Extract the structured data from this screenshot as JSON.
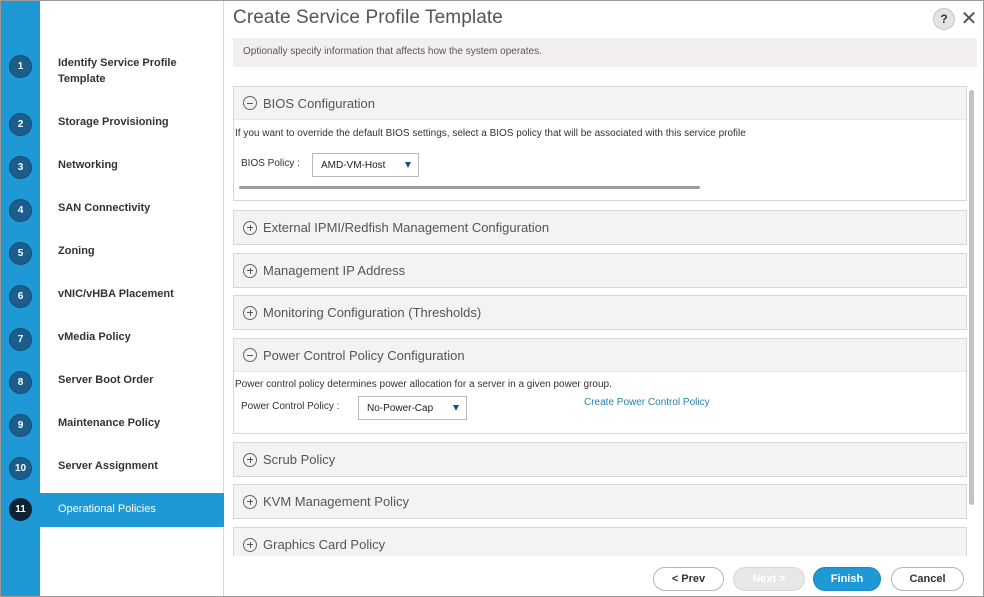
{
  "window": {
    "title": "Create Service Profile Template",
    "help_label": "?",
    "close_label": "✕"
  },
  "steps": [
    {
      "num": "1",
      "label": "Identify Service Profile Template"
    },
    {
      "num": "2",
      "label": "Storage Provisioning"
    },
    {
      "num": "3",
      "label": "Networking"
    },
    {
      "num": "4",
      "label": "SAN Connectivity"
    },
    {
      "num": "5",
      "label": "Zoning"
    },
    {
      "num": "6",
      "label": "vNIC/vHBA Placement"
    },
    {
      "num": "7",
      "label": "vMedia Policy"
    },
    {
      "num": "8",
      "label": "Server Boot Order"
    },
    {
      "num": "9",
      "label": "Maintenance Policy"
    },
    {
      "num": "10",
      "label": "Server Assignment"
    },
    {
      "num": "11",
      "label": "Operational Policies"
    }
  ],
  "active_step": "11",
  "info": "Optionally specify information that affects how the system operates.",
  "sections": {
    "bios": {
      "title": "BIOS Configuration",
      "description": "If you want to override the default BIOS settings, select a BIOS policy that will be associated with this service profile",
      "policy_label": "BIOS Policy :",
      "policy_value": "AMD-VM-Host"
    },
    "ipmi": {
      "title": "External IPMI/Redfish Management Configuration"
    },
    "mgmt_ip": {
      "title": "Management IP Address"
    },
    "monitoring": {
      "title": "Monitoring Configuration (Thresholds)"
    },
    "power": {
      "title": "Power Control Policy Configuration",
      "description": "Power control policy determines power allocation for a server in a given power group.",
      "policy_label": "Power Control Policy :",
      "policy_value": "No-Power-Cap",
      "create_link": "Create Power Control Policy"
    },
    "scrub": {
      "title": "Scrub Policy"
    },
    "kvm": {
      "title": "KVM Management Policy"
    },
    "graphics": {
      "title": "Graphics Card Policy"
    }
  },
  "footer": {
    "prev": "< Prev",
    "next": "Next >",
    "finish": "Finish",
    "cancel": "Cancel"
  },
  "colors": {
    "accent": "#1f98d6",
    "step_badge": "#1b5d8c",
    "link": "#2a7fb0"
  }
}
